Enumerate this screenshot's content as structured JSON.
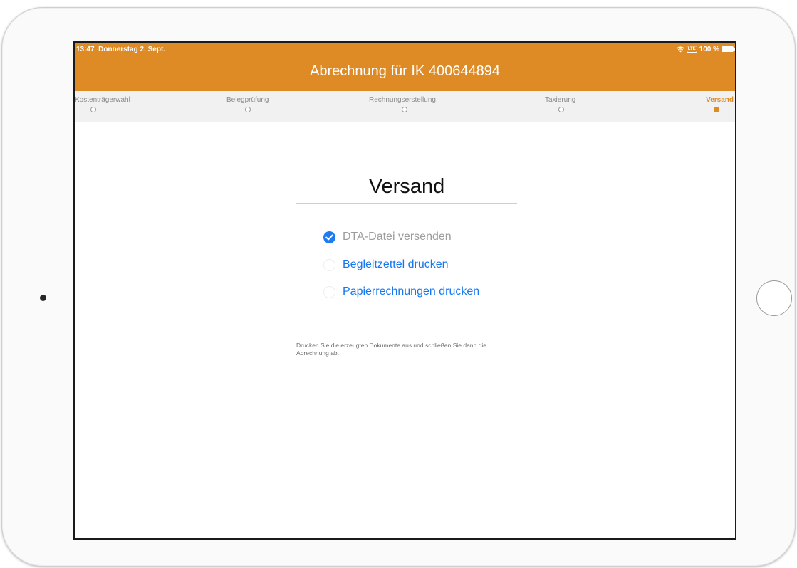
{
  "status_bar": {
    "time": "13:47",
    "date": "Donnerstag 2. Sept.",
    "network_badge": "LTE",
    "battery": "100 %"
  },
  "header": {
    "title": "Abrechnung für IK 400644894",
    "background_color": "#df8b25"
  },
  "steps": [
    {
      "label": "Kostenträgerwahl",
      "active": false
    },
    {
      "label": "Belegprüfung",
      "active": false
    },
    {
      "label": "Rechnungserstellung",
      "active": false
    },
    {
      "label": "Taxierung",
      "active": false
    },
    {
      "label": "Versand",
      "active": true
    }
  ],
  "main": {
    "title": "Versand",
    "options": [
      {
        "label": "DTA-Datei versenden",
        "checked": true,
        "enabled": false
      },
      {
        "label": "Begleitzettel drucken",
        "checked": false,
        "enabled": true
      },
      {
        "label": "Papierrechnungen drucken",
        "checked": false,
        "enabled": true
      }
    ],
    "hint": "Drucken Sie die erzeugten Dokumente aus und schließen Sie dann die Abrechnung ab."
  },
  "colors": {
    "accent": "#df8b25",
    "link": "#1677f2",
    "check": "#1e7bf0"
  }
}
